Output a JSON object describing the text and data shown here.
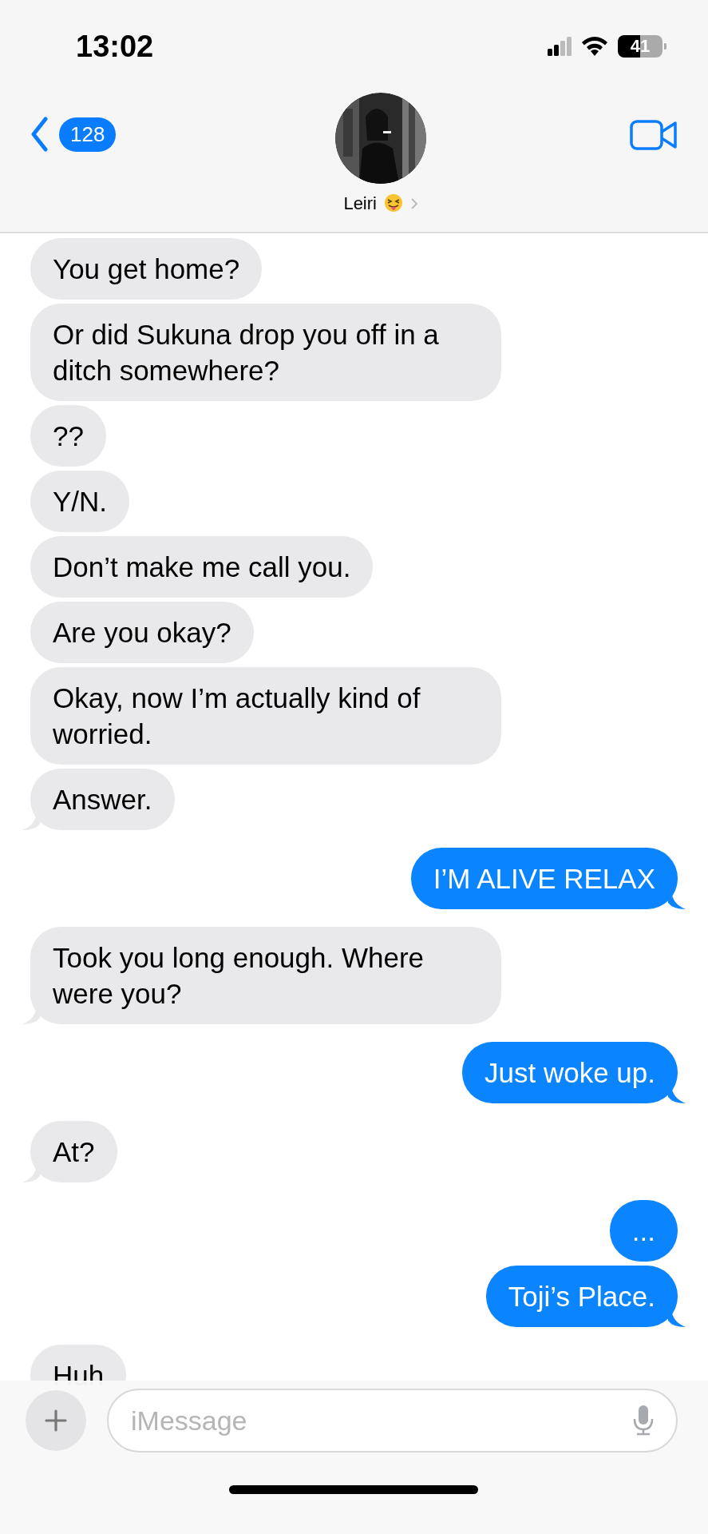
{
  "status_bar": {
    "time": "13:02",
    "battery_text": "41"
  },
  "header": {
    "back_count": "128",
    "contact_name": "Leiri"
  },
  "messages": [
    {
      "kind": "received",
      "text": "You get home?"
    },
    {
      "kind": "received",
      "text": "Or did Sukuna drop you off in a ditch somewhere?"
    },
    {
      "kind": "received",
      "text": "??"
    },
    {
      "kind": "received",
      "text": "Y/N."
    },
    {
      "kind": "received",
      "text": "Don’t make me call you."
    },
    {
      "kind": "received",
      "text": "Are you okay?"
    },
    {
      "kind": "received",
      "text": "Okay, now I’m actually kind of worried."
    },
    {
      "kind": "received",
      "text": "Answer."
    },
    {
      "kind": "sent",
      "text": "I’M ALIVE RELAX"
    },
    {
      "kind": "received",
      "text": "Took you long enough. Where were you?"
    },
    {
      "kind": "sent",
      "text": "Just woke up."
    },
    {
      "kind": "received",
      "text": "At?"
    },
    {
      "kind": "sent",
      "text": "..."
    },
    {
      "kind": "sent",
      "text": "Toji’s Place."
    },
    {
      "kind": "received",
      "text": "Huh"
    }
  ],
  "composer": {
    "placeholder": "iMessage"
  }
}
